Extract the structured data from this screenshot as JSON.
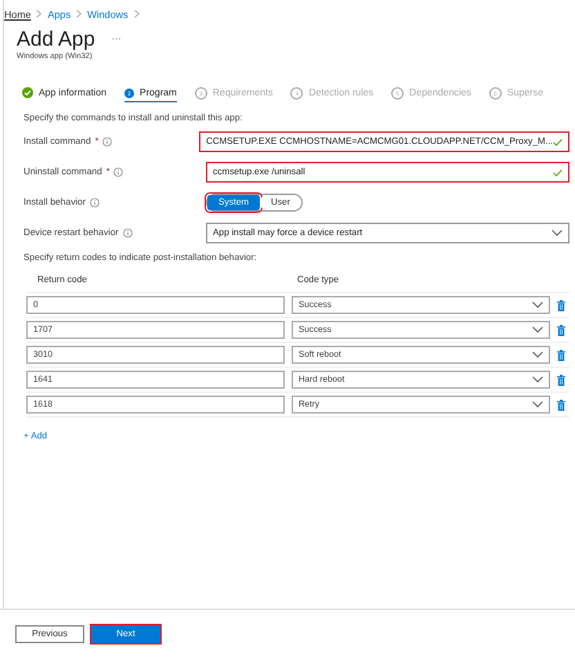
{
  "breadcrumb": [
    "Home",
    "Apps",
    "Windows"
  ],
  "title": "Add App",
  "more": "···",
  "subtitle": "Windows app (Win32)",
  "steps": [
    {
      "label": "App information",
      "kind": "done",
      "selected": false
    },
    {
      "label": "Program",
      "number": "2",
      "kind": "current",
      "selected": true
    },
    {
      "label": "Requirements",
      "number": "3",
      "kind": "pending",
      "selected": false
    },
    {
      "label": "Detection rules",
      "number": "4",
      "kind": "pending",
      "selected": false
    },
    {
      "label": "Dependencies",
      "number": "5",
      "kind": "pending",
      "selected": false
    },
    {
      "label": "Superse",
      "number": "6",
      "kind": "pending",
      "selected": false
    }
  ],
  "intro": "Specify the commands to install and uninstall this app:",
  "fields": [
    {
      "kind": "text",
      "label": "Install command",
      "required_mark": "*",
      "value": "CCMSETUP.EXE CCMHOSTNAME=ACMCMG01.CLOUDAPP.NET/CCM_Proxy_M...",
      "valid": true,
      "highlighted": true
    },
    {
      "kind": "text",
      "label": "Uninstall command",
      "required_mark": "*",
      "value": "ccmsetup.exe /uninsall",
      "valid": true,
      "highlighted": true
    },
    {
      "kind": "toggle",
      "label": "Install behavior",
      "options": [
        {
          "label": "System",
          "selected": true,
          "highlighted": true
        },
        {
          "label": "User",
          "selected": false,
          "highlighted": false
        }
      ]
    },
    {
      "kind": "dropdown",
      "label": "Device restart behavior",
      "value": "App install may force a device restart"
    }
  ],
  "codes_intro": "Specify return codes to indicate post-installation behavior:",
  "table": {
    "columns": [
      "Return code",
      "Code type"
    ],
    "rows": [
      {
        "code": "0",
        "type": "Success"
      },
      {
        "code": "1707",
        "type": "Success"
      },
      {
        "code": "3010",
        "type": "Soft reboot"
      },
      {
        "code": "1641",
        "type": "Hard reboot"
      },
      {
        "code": "1618",
        "type": "Retry"
      }
    ]
  },
  "add": "+ Add",
  "buttons": [
    {
      "label": "Previous",
      "kind": "secondary",
      "highlighted": false
    },
    {
      "label": "Next",
      "kind": "primary",
      "highlighted": true
    }
  ]
}
